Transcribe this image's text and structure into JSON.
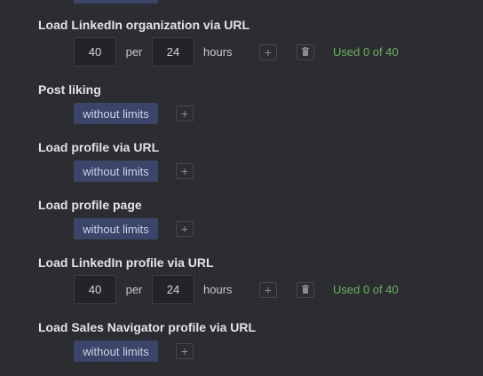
{
  "sections": [
    {
      "title": "Load LinkedIn organization via URL",
      "count": "40",
      "per_label": "per",
      "period": "24",
      "unit_label": "hours",
      "add_icon": "plus-icon",
      "delete_icon": "trash-icon",
      "usage": "Used 0 of 40"
    },
    {
      "title": "Post liking",
      "limit_label": "without limits",
      "add_icon": "plus-icon"
    },
    {
      "title": "Load profile via URL",
      "limit_label": "without limits",
      "add_icon": "plus-icon"
    },
    {
      "title": "Load profile page",
      "limit_label": "without limits",
      "add_icon": "plus-icon"
    },
    {
      "title": "Load LinkedIn profile via URL",
      "count": "40",
      "per_label": "per",
      "period": "24",
      "unit_label": "hours",
      "add_icon": "plus-icon",
      "delete_icon": "trash-icon",
      "usage": "Used 0 of 40"
    },
    {
      "title": "Load Sales Navigator profile via URL",
      "limit_label": "without limits",
      "add_icon": "plus-icon"
    }
  ],
  "colors": {
    "background": "#2b2d31",
    "pill": "#3a4569",
    "usage_green": "#6bb35c"
  }
}
